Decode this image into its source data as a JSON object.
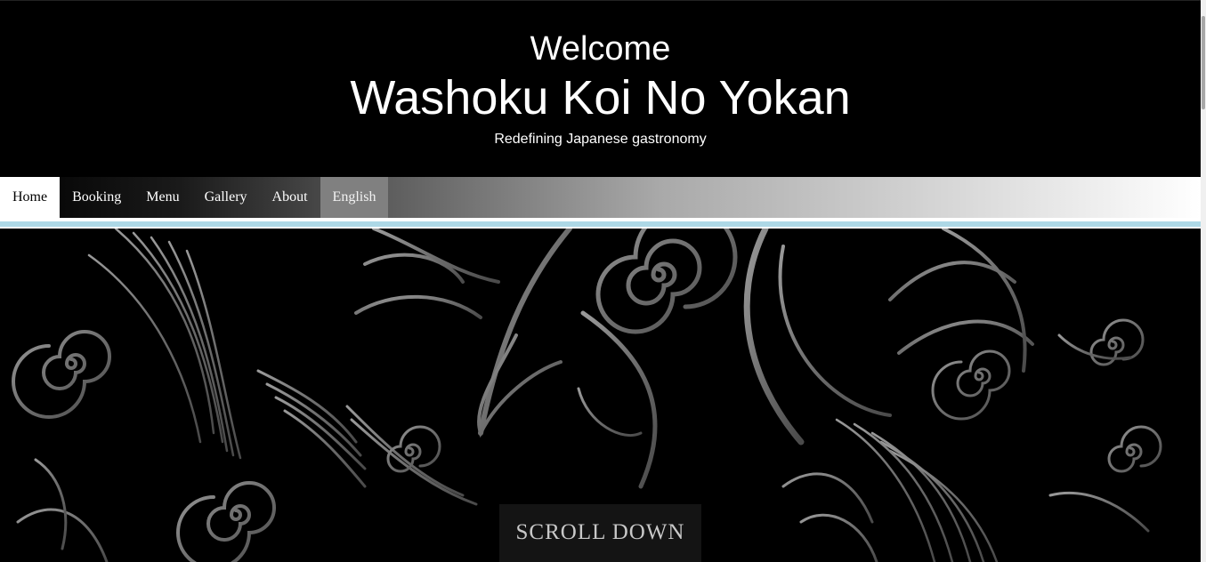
{
  "header": {
    "welcome": "Welcome",
    "title": "Washoku Koi No Yokan",
    "tagline": "Redefining Japanese gastronomy"
  },
  "nav": {
    "items": [
      {
        "label": "Home",
        "active": true
      },
      {
        "label": "Booking"
      },
      {
        "label": "Menu"
      },
      {
        "label": "Gallery"
      },
      {
        "label": "About"
      },
      {
        "label": "English",
        "language": true
      }
    ]
  },
  "hero": {
    "scroll_label": "SCROLL DOWN"
  },
  "colors": {
    "background": "#000000",
    "accent_line": "#add8e6",
    "swirl": "#7a7a7a"
  }
}
